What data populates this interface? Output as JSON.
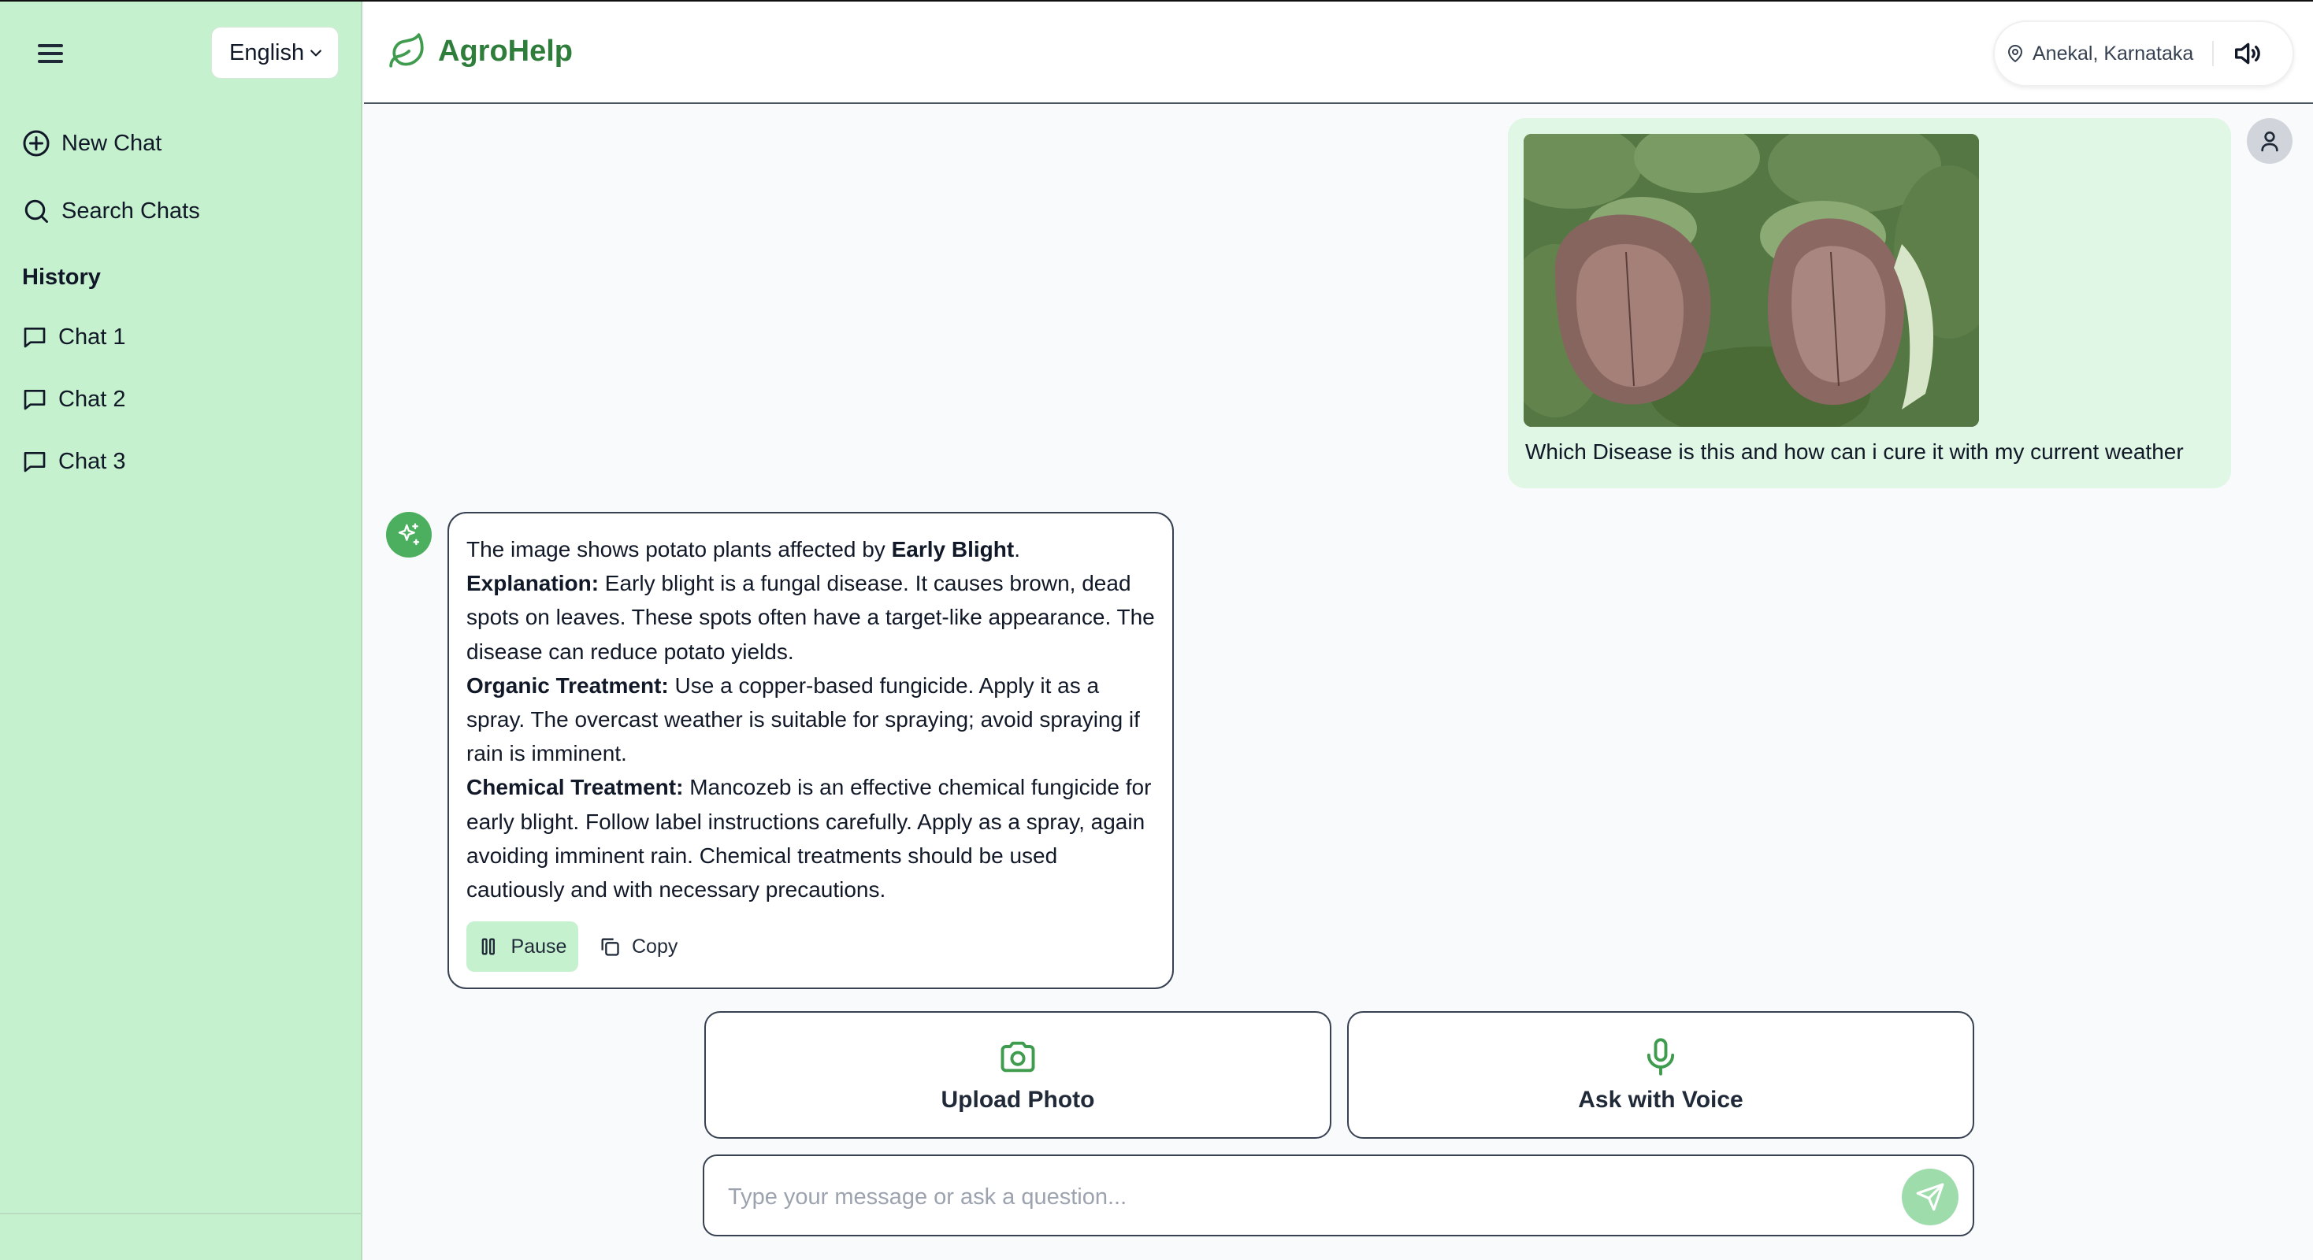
{
  "sidebar": {
    "language": "English",
    "new_chat": "New Chat",
    "search_chats": "Search Chats",
    "history_title": "History",
    "chats": [
      "Chat 1",
      "Chat 2",
      "Chat 3"
    ]
  },
  "header": {
    "brand": "AgroHelp",
    "location": "Anekal, Karnataka"
  },
  "conversation": {
    "user_message": "Which Disease is this and how can i cure it with my current weather",
    "bot": {
      "intro_prefix": "The image shows potato plants affected by ",
      "intro_disease": "Early Blight",
      "intro_suffix": ".",
      "explanation_label": "Explanation:",
      "explanation_text": " Early blight is a fungal disease. It causes brown, dead spots on leaves. These spots often have a target-like appearance. The disease can reduce potato yields.",
      "organic_label": "Organic Treatment:",
      "organic_text": " Use a copper-based fungicide. Apply it as a spray. The overcast weather is suitable for spraying; avoid spraying if rain is imminent.",
      "chemical_label": "Chemical Treatment:",
      "chemical_text": " Mancozeb is an effective chemical fungicide for early blight. Follow label instructions carefully. Apply as a spray, again avoiding imminent rain. Chemical treatments should be used cautiously and with necessary precautions.",
      "pause_label": "Pause",
      "copy_label": "Copy"
    }
  },
  "actions": {
    "upload_photo": "Upload Photo",
    "ask_voice": "Ask with Voice"
  },
  "input": {
    "placeholder": "Type your message or ask a question..."
  },
  "colors": {
    "sidebar_bg": "#c6f1cf",
    "brand_green": "#2f7d3b",
    "user_bubble": "#dff7e4",
    "bot_avatar": "#4caf5f",
    "send_button": "#9fdcac"
  },
  "icons": {
    "menu": "hamburger-icon",
    "new_chat": "plus-circle-icon",
    "search": "search-icon",
    "chat": "message-square-icon",
    "brand": "leaf-icon",
    "location": "map-pin-icon",
    "speaker": "speaker-icon",
    "user": "user-icon",
    "bot": "sparkles-icon",
    "pause": "pause-icon",
    "copy": "copy-icon",
    "camera": "camera-icon",
    "mic": "mic-icon",
    "send": "send-icon"
  }
}
